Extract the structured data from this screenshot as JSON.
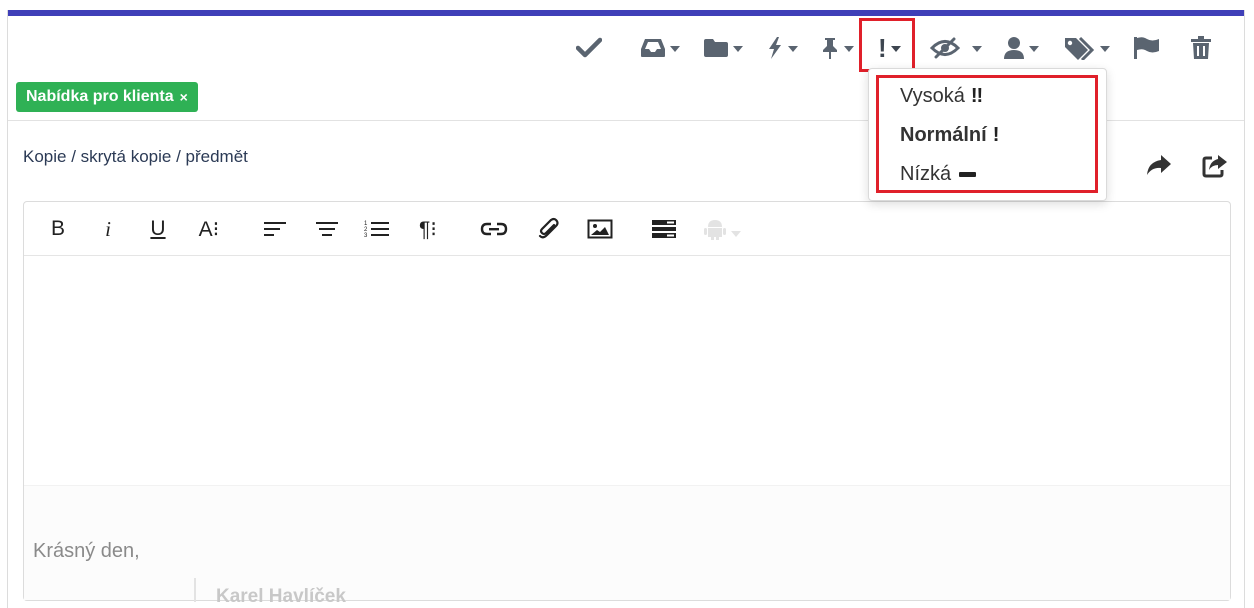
{
  "toolbar": {
    "icons": [
      {
        "name": "check-icon"
      },
      {
        "name": "inbox-icon"
      },
      {
        "name": "folder-icon"
      },
      {
        "name": "bolt-icon"
      },
      {
        "name": "pin-icon"
      },
      {
        "name": "priority-icon"
      },
      {
        "name": "eye-slash-icon"
      },
      {
        "name": "user-icon"
      },
      {
        "name": "tags-icon"
      },
      {
        "name": "flag-icon"
      },
      {
        "name": "trash-icon"
      }
    ],
    "priority_symbol": "!"
  },
  "tag": {
    "label": "Nabídka pro klienta",
    "remove": "×",
    "color": "#2fb155"
  },
  "compose": {
    "cc_bcc_subject_link": "Kopie / skrytá kopie / předmět"
  },
  "editor": {
    "toolbar": {
      "bold": "B",
      "italic": "i",
      "underline": "U",
      "font_size": "A⁝",
      "align_left": "align-left-icon",
      "align_center": "align-center-icon",
      "numbered_list": "numbered-list-icon",
      "paragraph": "¶⁝",
      "link": "link-icon",
      "attachment": "paperclip-icon",
      "image": "image-icon",
      "template": "template-icon",
      "android": "android-icon"
    },
    "signature": {
      "greeting": "Krásný den,",
      "name": "Karel Havlíček"
    }
  },
  "priority_menu": {
    "items": [
      {
        "label": "Vysoká",
        "mark": "!!"
      },
      {
        "label": "Normální",
        "mark": "!"
      },
      {
        "label": "Nízká",
        "mark": ""
      }
    ]
  },
  "colors": {
    "accent_bar": "#3f3fb8",
    "highlight": "#e0202a",
    "icon": "#5a6470"
  }
}
